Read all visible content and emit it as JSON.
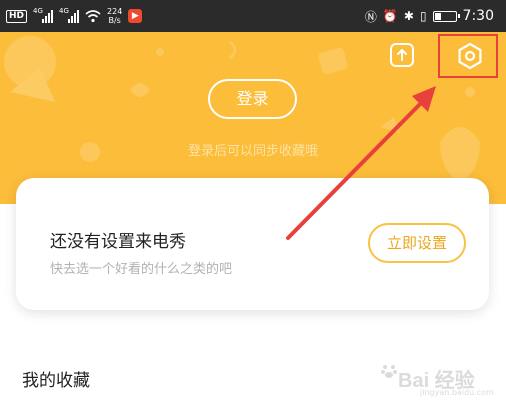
{
  "status_bar": {
    "hd_label": "HD",
    "signal_1_label": "4G",
    "signal_2_label": "4G",
    "rate_value": "224",
    "rate_unit": "B/s",
    "time": "7:30",
    "battery_level": 0.3
  },
  "header": {
    "login_label": "登录",
    "login_hint": "登录后可以同步收藏哦",
    "upload_icon": "upload-icon",
    "settings_icon": "settings-gear-icon"
  },
  "promo_card": {
    "title": "还没有设置来电秀",
    "subtitle": "快去选一个好看的什么之类的吧",
    "button_label": "立即设置"
  },
  "favorites": {
    "title": "我的收藏"
  },
  "annotation": {
    "highlight_color": "#e8403a"
  },
  "watermark": {
    "text": "Bai 经验",
    "sub": "jingyan.baidu.com"
  },
  "colors": {
    "accent": "#fbbd3a",
    "button_text": "#e9a81d"
  }
}
